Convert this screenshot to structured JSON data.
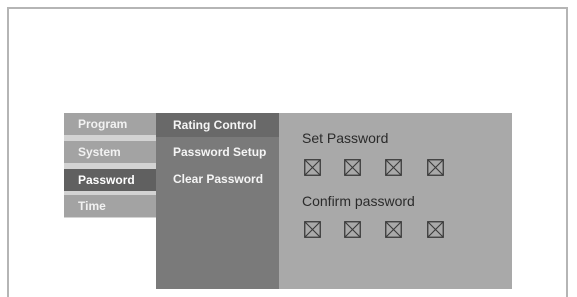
{
  "menu": {
    "items": [
      {
        "label": "Program"
      },
      {
        "label": "System"
      },
      {
        "label": "Password"
      },
      {
        "label": "Time"
      }
    ],
    "active_index": 2
  },
  "submenu": {
    "items": [
      {
        "label": "Rating Control"
      },
      {
        "label": "Password Setup"
      },
      {
        "label": "Clear Password"
      }
    ]
  },
  "panel": {
    "set_password_label": "Set Password",
    "confirm_password_label": "Confirm password",
    "digit_placeholder_icon": "x-box-icon"
  },
  "colors": {
    "menu_active": "#606060",
    "menu_inactive": "#a3a3a3",
    "submenu_bg": "#7a7a7a",
    "panel_bg": "#a9a9a9"
  }
}
